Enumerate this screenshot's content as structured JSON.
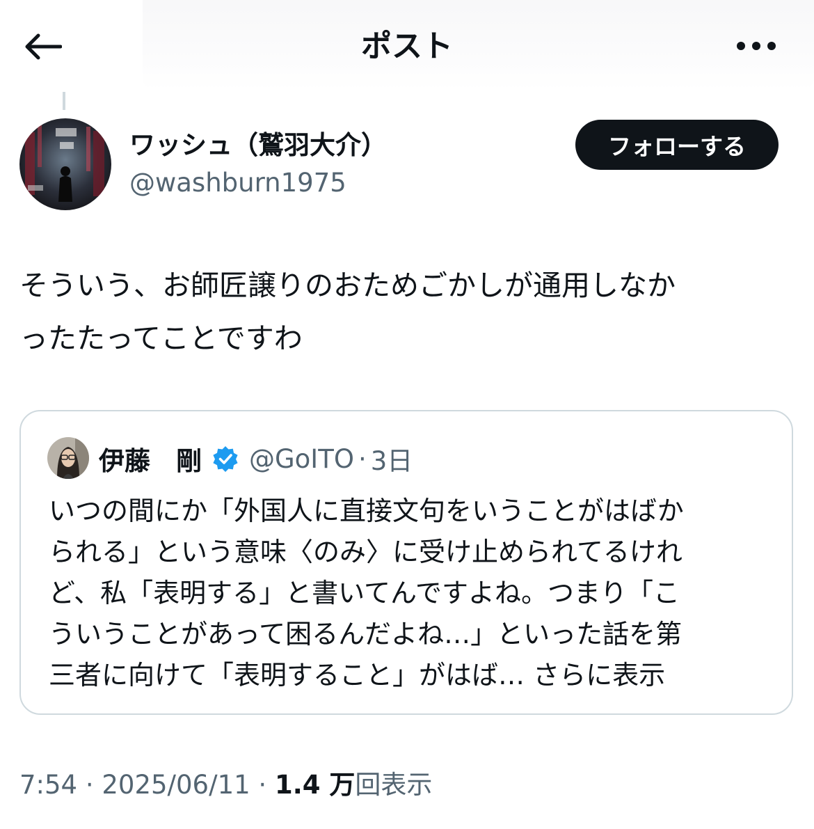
{
  "header": {
    "title": "ポスト",
    "back_icon": "arrow-left-icon",
    "more_icon": "more-horizontal-icon"
  },
  "author": {
    "display_name": "ワッシュ（鷲羽大介）",
    "handle": "@washburn1975",
    "follow_label": "フォローする"
  },
  "post": {
    "text": "そういう、お師匠譲りのおためごかしが通用しなか\nったたってことですわ"
  },
  "quote": {
    "name": "伊藤　剛",
    "verified_icon": "verified-badge-icon",
    "handle": "@GoITO",
    "separator": "·",
    "time": "3日",
    "text": "いつの間にか「外国人に直接文句をいうことがはばか\nられる」という意味〈のみ〉に受け止められてるけれ\nど、私「表明する」と書いてんですよね。つまり「こ\nういうことがあって困るんだよね…」といった話を第\n三者に向けて「表明すること」がはば…",
    "more_label": "さらに表示"
  },
  "meta": {
    "time": "7:54",
    "sep1": " · ",
    "date": "2025/06/11",
    "sep2": " · ",
    "views_count": "1.4 万",
    "views_label": "回表示"
  },
  "colors": {
    "text": "#0f1419",
    "secondary": "#536471",
    "border": "#cfd9de",
    "verified": "#1d9bf0",
    "button_bg": "#0f1419"
  }
}
